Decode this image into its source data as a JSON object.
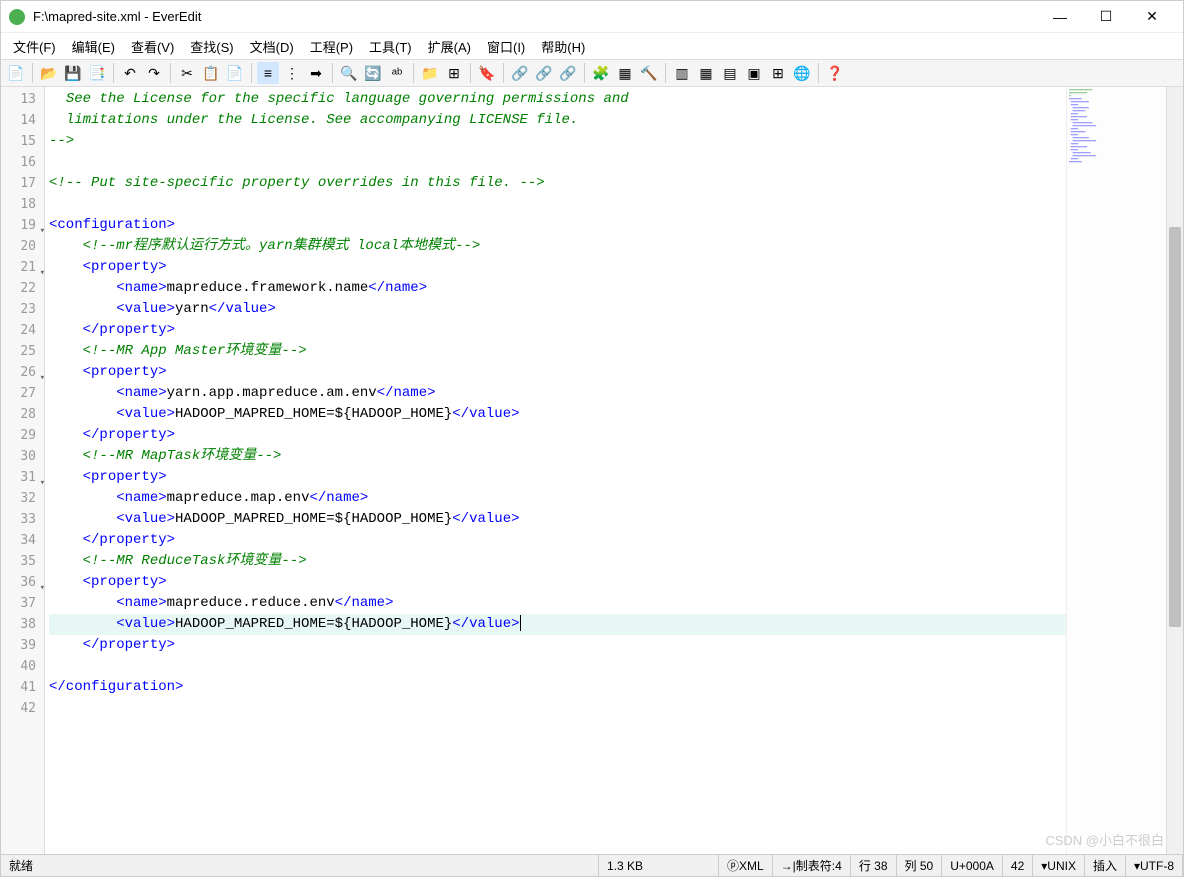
{
  "window": {
    "title": "F:\\mapred-site.xml - EverEdit"
  },
  "menu": {
    "file": "文件(F)",
    "edit": "编辑(E)",
    "view": "查看(V)",
    "search": "查找(S)",
    "document": "文档(D)",
    "project": "工程(P)",
    "tools": "工具(T)",
    "extend": "扩展(A)",
    "window": "窗口(I)",
    "help": "帮助(H)"
  },
  "code": {
    "lines": [
      {
        "n": 13,
        "type": "comment",
        "indent": "  ",
        "text": "See the License for the specific language governing permissions and"
      },
      {
        "n": 14,
        "type": "comment",
        "indent": "  ",
        "text": "limitations under the License. See accompanying LICENSE file."
      },
      {
        "n": 15,
        "type": "comment",
        "indent": "",
        "text": "-->"
      },
      {
        "n": 16,
        "type": "blank",
        "indent": "",
        "text": ""
      },
      {
        "n": 17,
        "type": "comment",
        "indent": "",
        "text": "<!-- Put site-specific property overrides in this file. -->"
      },
      {
        "n": 18,
        "type": "blank",
        "indent": "",
        "text": ""
      },
      {
        "n": 19,
        "fold": true,
        "type": "tag",
        "indent": "",
        "open": "<configuration>",
        "txt": "",
        "close": ""
      },
      {
        "n": 20,
        "type": "comment",
        "indent": "    ",
        "text": "<!--mr程序默认运行方式。yarn集群模式 local本地模式-->"
      },
      {
        "n": 21,
        "fold": true,
        "type": "tag",
        "indent": "    ",
        "open": "<property>",
        "txt": "",
        "close": ""
      },
      {
        "n": 22,
        "type": "tag",
        "indent": "        ",
        "open": "<name>",
        "txt": "mapreduce.framework.name",
        "close": "</name>"
      },
      {
        "n": 23,
        "type": "tag",
        "indent": "        ",
        "open": "<value>",
        "txt": "yarn",
        "close": "</value>"
      },
      {
        "n": 24,
        "type": "tag",
        "indent": "    ",
        "open": "</property>",
        "txt": "",
        "close": ""
      },
      {
        "n": 25,
        "type": "comment",
        "indent": "    ",
        "text": "<!--MR App Master环境变量-->"
      },
      {
        "n": 26,
        "fold": true,
        "type": "tag",
        "indent": "    ",
        "open": "<property>",
        "txt": "",
        "close": ""
      },
      {
        "n": 27,
        "type": "tag",
        "indent": "        ",
        "open": "<name>",
        "txt": "yarn.app.mapreduce.am.env",
        "close": "</name>"
      },
      {
        "n": 28,
        "type": "tag",
        "indent": "        ",
        "open": "<value>",
        "txt": "HADOOP_MAPRED_HOME=${HADOOP_HOME}",
        "close": "</value>"
      },
      {
        "n": 29,
        "type": "tag",
        "indent": "    ",
        "open": "</property>",
        "txt": "",
        "close": ""
      },
      {
        "n": 30,
        "type": "comment",
        "indent": "    ",
        "text": "<!--MR MapTask环境变量-->"
      },
      {
        "n": 31,
        "fold": true,
        "type": "tag",
        "indent": "    ",
        "open": "<property>",
        "txt": "",
        "close": ""
      },
      {
        "n": 32,
        "type": "tag",
        "indent": "        ",
        "open": "<name>",
        "txt": "mapreduce.map.env",
        "close": "</name>"
      },
      {
        "n": 33,
        "type": "tag",
        "indent": "        ",
        "open": "<value>",
        "txt": "HADOOP_MAPRED_HOME=${HADOOP_HOME}",
        "close": "</value>"
      },
      {
        "n": 34,
        "type": "tag",
        "indent": "    ",
        "open": "</property>",
        "txt": "",
        "close": ""
      },
      {
        "n": 35,
        "type": "comment",
        "indent": "    ",
        "text": "<!--MR ReduceTask环境变量-->"
      },
      {
        "n": 36,
        "fold": true,
        "type": "tag",
        "indent": "    ",
        "open": "<property>",
        "txt": "",
        "close": ""
      },
      {
        "n": 37,
        "type": "tag",
        "indent": "        ",
        "open": "<name>",
        "txt": "mapreduce.reduce.env",
        "close": "</name>"
      },
      {
        "n": 38,
        "highlight": true,
        "cursor": true,
        "type": "tag",
        "indent": "        ",
        "open": "<value>",
        "txt": "HADOOP_MAPRED_HOME=${HADOOP_HOME}",
        "close": "</value>"
      },
      {
        "n": 39,
        "type": "tag",
        "indent": "    ",
        "open": "</property>",
        "txt": "",
        "close": ""
      },
      {
        "n": 40,
        "type": "blank",
        "indent": "",
        "text": ""
      },
      {
        "n": 41,
        "type": "tag",
        "indent": "",
        "open": "</configuration>",
        "txt": "",
        "close": ""
      },
      {
        "n": 42,
        "type": "blank",
        "indent": "",
        "text": ""
      }
    ]
  },
  "status": {
    "ready": "就绪",
    "size": "1.3 KB",
    "lang": "XML",
    "tabs": "制表符:4",
    "line": "行 38",
    "col": "列 50",
    "unicode": "U+000A",
    "num": "42",
    "os": "UNIX",
    "mode": "插入",
    "encoding": "UTF-8"
  },
  "watermark": "CSDN @小白不很白"
}
